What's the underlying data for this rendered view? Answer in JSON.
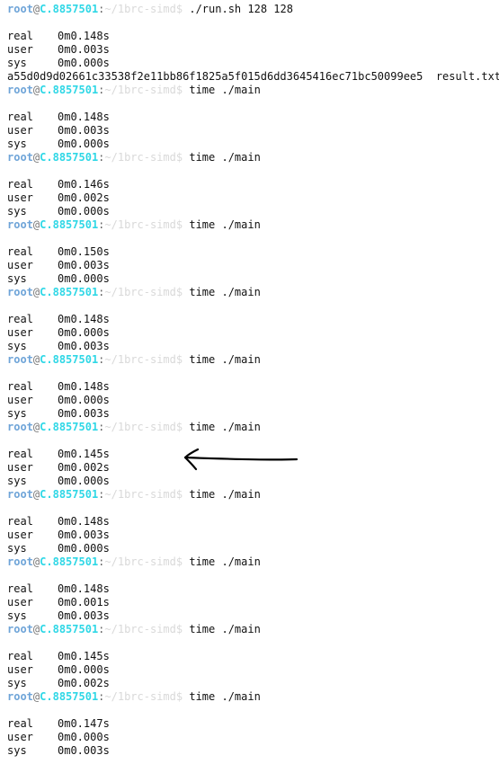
{
  "prompt": {
    "user": "root",
    "at": "@",
    "host": "C.8857501",
    "colon": ":",
    "path": "~/1brc-simd",
    "dollar": "$"
  },
  "lines": [
    {
      "type": "prompt",
      "command": " ./run.sh 128 128"
    },
    {
      "type": "blank"
    },
    {
      "type": "time",
      "label": "real",
      "value": "0m0.148s"
    },
    {
      "type": "time",
      "label": "user",
      "value": "0m0.003s"
    },
    {
      "type": "time",
      "label": "sys",
      "value": "0m0.000s"
    },
    {
      "type": "text",
      "text": "a55d0d9d02661c33538f2e11bb86f1825a5f015d6dd3645416ec71bc50099ee5  result.txt"
    },
    {
      "type": "prompt",
      "command": " time ./main"
    },
    {
      "type": "blank"
    },
    {
      "type": "time",
      "label": "real",
      "value": "0m0.148s"
    },
    {
      "type": "time",
      "label": "user",
      "value": "0m0.003s"
    },
    {
      "type": "time",
      "label": "sys",
      "value": "0m0.000s"
    },
    {
      "type": "prompt",
      "command": " time ./main"
    },
    {
      "type": "blank"
    },
    {
      "type": "time",
      "label": "real",
      "value": "0m0.146s"
    },
    {
      "type": "time",
      "label": "user",
      "value": "0m0.002s"
    },
    {
      "type": "time",
      "label": "sys",
      "value": "0m0.000s"
    },
    {
      "type": "prompt",
      "command": " time ./main"
    },
    {
      "type": "blank"
    },
    {
      "type": "time",
      "label": "real",
      "value": "0m0.150s"
    },
    {
      "type": "time",
      "label": "user",
      "value": "0m0.003s"
    },
    {
      "type": "time",
      "label": "sys",
      "value": "0m0.000s"
    },
    {
      "type": "prompt",
      "command": " time ./main"
    },
    {
      "type": "blank"
    },
    {
      "type": "time",
      "label": "real",
      "value": "0m0.148s"
    },
    {
      "type": "time",
      "label": "user",
      "value": "0m0.000s"
    },
    {
      "type": "time",
      "label": "sys",
      "value": "0m0.003s"
    },
    {
      "type": "prompt",
      "command": " time ./main"
    },
    {
      "type": "blank"
    },
    {
      "type": "time",
      "label": "real",
      "value": "0m0.148s"
    },
    {
      "type": "time",
      "label": "user",
      "value": "0m0.000s"
    },
    {
      "type": "time",
      "label": "sys",
      "value": "0m0.003s"
    },
    {
      "type": "prompt",
      "command": " time ./main"
    },
    {
      "type": "blank"
    },
    {
      "type": "time",
      "label": "real",
      "value": "0m0.145s"
    },
    {
      "type": "time",
      "label": "user",
      "value": "0m0.002s"
    },
    {
      "type": "time",
      "label": "sys",
      "value": "0m0.000s"
    },
    {
      "type": "prompt",
      "command": " time ./main"
    },
    {
      "type": "blank"
    },
    {
      "type": "time",
      "label": "real",
      "value": "0m0.148s"
    },
    {
      "type": "time",
      "label": "user",
      "value": "0m0.003s"
    },
    {
      "type": "time",
      "label": "sys",
      "value": "0m0.000s"
    },
    {
      "type": "prompt",
      "command": " time ./main"
    },
    {
      "type": "blank"
    },
    {
      "type": "time",
      "label": "real",
      "value": "0m0.148s"
    },
    {
      "type": "time",
      "label": "user",
      "value": "0m0.001s"
    },
    {
      "type": "time",
      "label": "sys",
      "value": "0m0.003s"
    },
    {
      "type": "prompt",
      "command": " time ./main"
    },
    {
      "type": "blank"
    },
    {
      "type": "time",
      "label": "real",
      "value": "0m0.145s"
    },
    {
      "type": "time",
      "label": "user",
      "value": "0m0.000s"
    },
    {
      "type": "time",
      "label": "sys",
      "value": "0m0.002s"
    },
    {
      "type": "prompt",
      "command": " time ./main"
    },
    {
      "type": "blank"
    },
    {
      "type": "time",
      "label": "real",
      "value": "0m0.147s"
    },
    {
      "type": "time",
      "label": "user",
      "value": "0m0.000s"
    },
    {
      "type": "time",
      "label": "sys",
      "value": "0m0.003s"
    }
  ],
  "annotation": {
    "icon": "hand-drawn-left-arrow-icon",
    "color": "#000000"
  }
}
